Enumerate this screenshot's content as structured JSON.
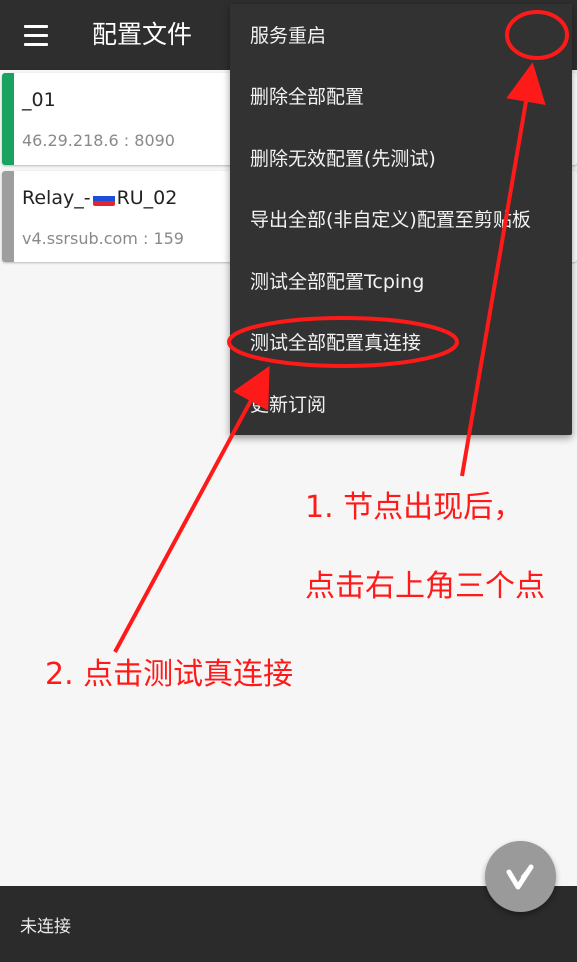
{
  "appbar": {
    "title": "配置文件",
    "menu_icon": "hamburger-menu-icon"
  },
  "servers": [
    {
      "name": "_01",
      "address": "46.29.218.6 : 8090",
      "status_color": "#1aa260"
    },
    {
      "name_prefix": "Relay_-",
      "flag": "russia-flag-icon",
      "name_suffix": "RU_02",
      "address": "v4.ssrsub.com : 159",
      "status_color": "#9e9e9e"
    }
  ],
  "overflow_menu": {
    "items": [
      "服务重启",
      "删除全部配置",
      "删除无效配置(先测试)",
      "导出全部(非自定义)配置至剪贴板",
      "测试全部配置Tcping",
      "测试全部配置真连接",
      "更新订阅"
    ]
  },
  "fab": {
    "icon": "v-logo-icon"
  },
  "status_bar": {
    "text": "未连接"
  },
  "annotations": {
    "step1_line1": "1. 节点出现后，",
    "step1_line2": "点击右上角三个点",
    "step2": "2. 点击测试真连接",
    "color": "#ff1a1a"
  }
}
